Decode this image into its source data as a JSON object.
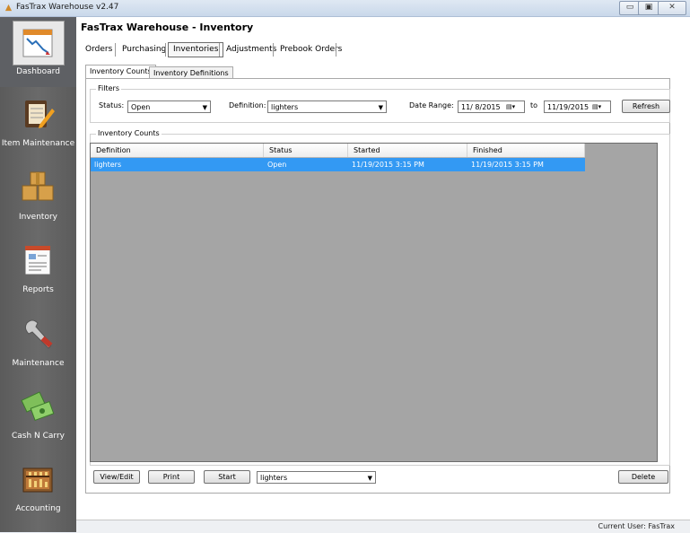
{
  "window": {
    "title": "FasTrax Warehouse v2.47",
    "minimize": "▭",
    "maximize": "▣",
    "close": "✕"
  },
  "sidebar": {
    "items": [
      {
        "label": "Dashboard",
        "icon": "dashboard-icon"
      },
      {
        "label": "Item Maintenance",
        "icon": "item-maintenance-icon"
      },
      {
        "label": "Inventory",
        "icon": "inventory-boxes-icon"
      },
      {
        "label": "Reports",
        "icon": "reports-icon"
      },
      {
        "label": "Maintenance",
        "icon": "wrench-icon"
      },
      {
        "label": "Cash N Carry",
        "icon": "cash-icon"
      },
      {
        "label": "Accounting",
        "icon": "abacus-icon"
      }
    ]
  },
  "page": {
    "title": "FasTrax Warehouse - Inventory",
    "tabs": [
      "Orders",
      "Purchasing",
      "Inventories",
      "Adjustments",
      "Prebook Orders"
    ],
    "active_tab": "Inventories"
  },
  "subtabs": [
    "Inventory Counts",
    "Inventory Definitions"
  ],
  "filters": {
    "legend": "Filters",
    "status_label": "Status:",
    "status_value": "Open",
    "definition_label": "Definition:",
    "definition_value": "lighters",
    "date_range_label": "Date Range:",
    "date_from": "11/ 8/2015",
    "to_label": "to",
    "date_to": "11/19/2015",
    "refresh_label": "Refresh"
  },
  "counts": {
    "legend": "Inventory Counts",
    "columns": [
      "Definition",
      "Status",
      "Started",
      "Finished"
    ],
    "rows": [
      {
        "definition": "lighters",
        "status": "Open",
        "started": "11/19/2015 3:15 PM",
        "finished": "11/19/2015 3:15 PM"
      }
    ]
  },
  "actions": {
    "view_edit": "View/Edit",
    "print": "Print",
    "start": "Start",
    "start_definition": "lighters",
    "delete": "Delete"
  },
  "status_bar": {
    "text": "Current User: FasTrax"
  },
  "colors": {
    "selection": "#3399f3",
    "sidebar": "#5e5e5e",
    "grid_bg": "#a5a5a5"
  }
}
